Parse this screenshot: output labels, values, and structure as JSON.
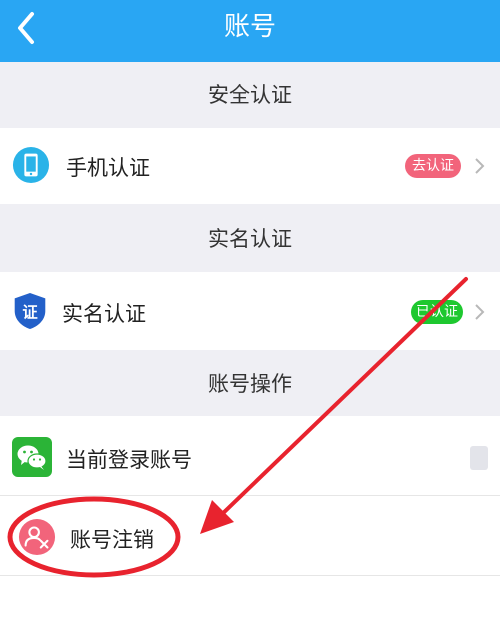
{
  "header": {
    "title": "账号"
  },
  "sections": {
    "security": {
      "title": "安全认证"
    },
    "realname": {
      "title": "实名认证"
    },
    "account": {
      "title": "账号操作"
    }
  },
  "rows": {
    "phone": {
      "label": "手机认证",
      "badge": "去认证",
      "icon": "phone-icon"
    },
    "realname": {
      "label": "实名认证",
      "badge": "已认证",
      "icon": "shield-icon"
    },
    "current": {
      "label": "当前登录账号",
      "icon": "wechat-icon"
    },
    "cancel": {
      "label": "账号注销",
      "icon": "user-remove-icon"
    }
  },
  "colors": {
    "header": "#29a6f3",
    "section_bg": "#efeff4",
    "badge_pending": "#f2647b",
    "badge_done": "#1ec82f",
    "annotation": "#e8232e"
  }
}
